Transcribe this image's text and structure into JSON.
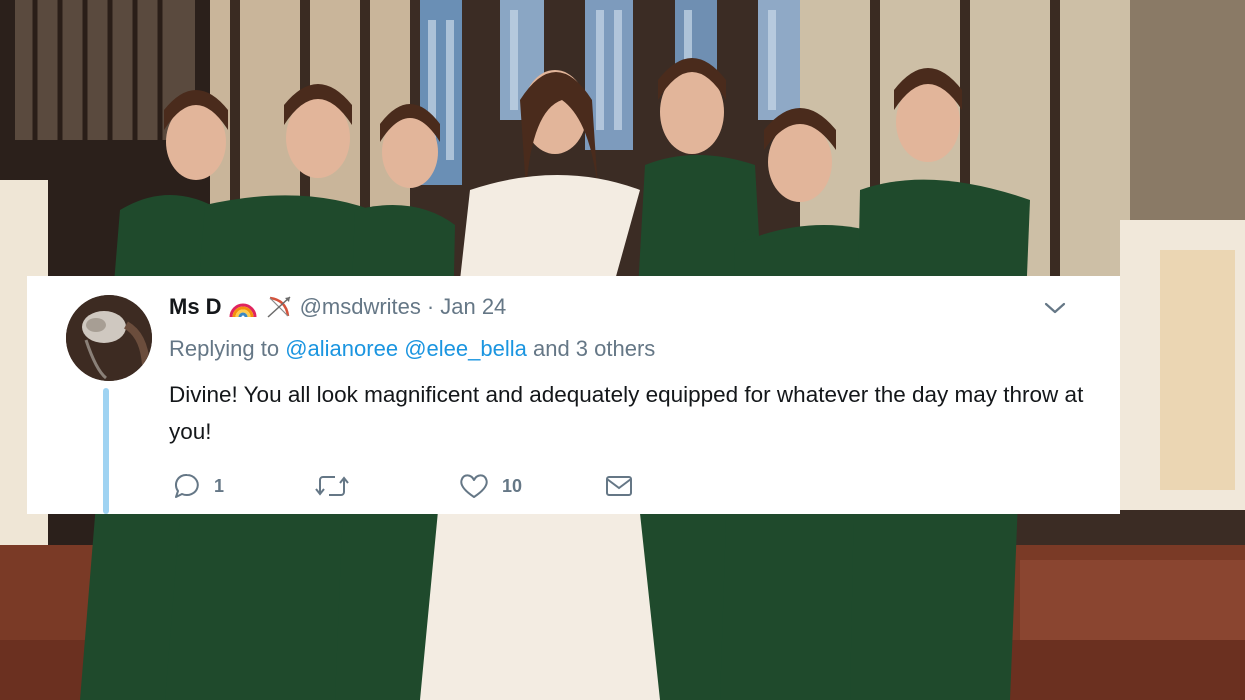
{
  "tweet": {
    "name": "Ms D",
    "emoji_icons": [
      "rainbow-icon",
      "bow-and-arrow-icon"
    ],
    "handle": "@msdwrites",
    "separator": "·",
    "date": "Jan 24",
    "replying_prefix": "Replying to",
    "mentions": [
      "@alianoree",
      "@elee_bella"
    ],
    "replying_suffix": "and 3 others",
    "text": "Divine! You all look magnificent and adequately equipped for whatever the day may throw at you!",
    "reply_count": "1",
    "retweet_count": "",
    "like_count": "10"
  },
  "colors": {
    "link": "#1b95e0",
    "muted": "#657786",
    "text": "#14171a",
    "thread": "#9fd3f2",
    "dress_green": "#1f4a2c"
  }
}
